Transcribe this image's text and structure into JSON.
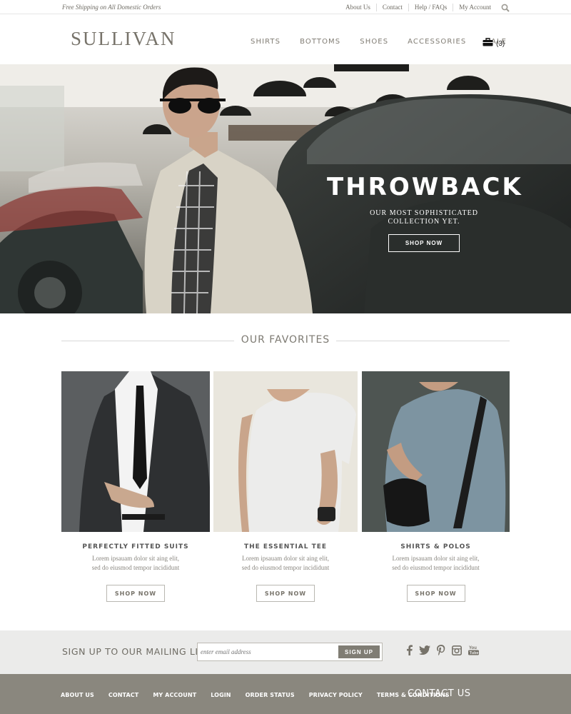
{
  "topbar": {
    "promo": "Free Shipping on All Domestic Orders",
    "links": [
      "About Us",
      "Contact",
      "Help / FAQs",
      "My Account"
    ]
  },
  "header": {
    "logo": "SULLIVAN",
    "nav": [
      "SHIRTS",
      "BOTTOMS",
      "SHOES",
      "ACCESSORIES",
      "SALE"
    ],
    "cart_count": "(3)"
  },
  "hero": {
    "headline": "THROWBACK",
    "subline_1": "OUR MOST SOPHISTICATED",
    "subline_2": "COLLECTION YET.",
    "cta": "SHOP NOW"
  },
  "favorites": {
    "title": "OUR FAVORITES",
    "items": [
      {
        "title": "PERFECTLY FITTED SUITS",
        "desc_1": "Lorem ipsauam dolor sit aing elit,",
        "desc_2": "sed do eiusmod tempor incididunt",
        "button": "SHOP NOW"
      },
      {
        "title": "THE ESSENTIAL TEE",
        "desc_1": "Lorem ipsauam dolor sit aing elit,",
        "desc_2": "sed do eiusmod tempor incididunt",
        "button": "SHOP NOW"
      },
      {
        "title": "SHIRTS & POLOS",
        "desc_1": "Lorem ipsauam dolor sit aing elit,",
        "desc_2": "sed do eiusmod tempor incididunt",
        "button": "SHOP NOW"
      }
    ]
  },
  "mailing": {
    "label": "SIGN UP TO OUR MAILING LIST",
    "placeholder": "enter email address",
    "button": "SIGN UP",
    "social_icons": [
      "facebook-icon",
      "twitter-icon",
      "pinterest-icon",
      "instagram-icon",
      "youtube-icon"
    ]
  },
  "footer": {
    "links": [
      "ABOUT US",
      "CONTACT",
      "MY ACCOUNT",
      "LOGIN",
      "ORDER STATUS",
      "PRIVACY POLICY",
      "TERMS & CONDITIONS"
    ],
    "contact": "CONTACT US"
  },
  "colors": {
    "brand_gray": "#77736a",
    "footer_bg": "#8a877e",
    "mailing_bg": "#ebebea",
    "button_bg": "#807d74"
  }
}
